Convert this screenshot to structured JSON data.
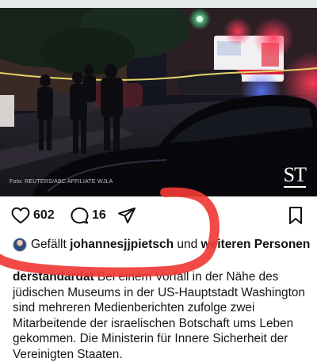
{
  "photo": {
    "credit": "Foto: REUTERS/ABC AFFILIATE WJLA",
    "logo": "ST"
  },
  "actions": {
    "likes_count": "602",
    "comments_count": "16"
  },
  "liked_by": {
    "prefix": "Gefällt",
    "user": "johannesjjpietsch",
    "connector": "und",
    "others": "weiteren Personen"
  },
  "caption": {
    "username": "derstandardat",
    "text": "Bei einem Vorfall in der Nähe des jüdischen Museums in der US-Hauptstadt Washington sind mehreren Medienberichten zufolge zwei Mitarbeitende der israelischen Botschaft ums Leben gekommen. Die Ministerin für Innere Sicherheit der Vereinigten Staaten."
  },
  "colors": {
    "annotation_red": "#f03a36",
    "police_red": "#e8334b",
    "police_blue": "#4c6cff",
    "signal_green": "#3cff8a"
  },
  "icons": [
    "heart-icon",
    "comment-icon",
    "share-icon",
    "bookmark-icon"
  ]
}
